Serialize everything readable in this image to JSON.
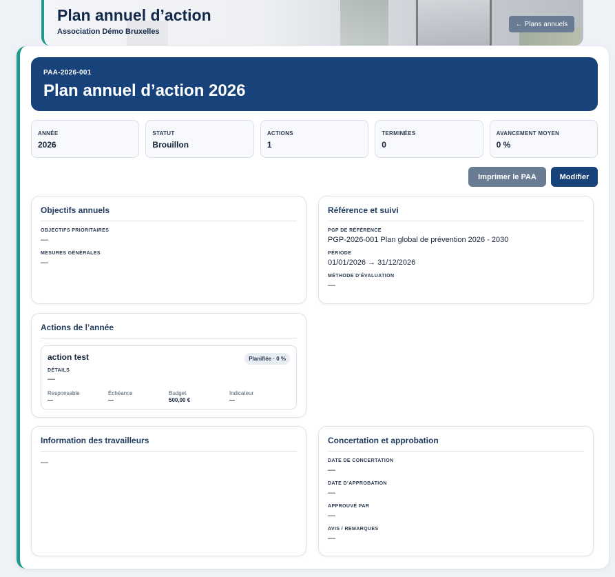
{
  "banner": {
    "title": "Plan annuel d’action",
    "subtitle": "Association Démo Bruxelles",
    "back_label": "← Plans annuels"
  },
  "hero": {
    "reference": "PAA-2026-001",
    "title": "Plan annuel d’action 2026"
  },
  "stats": [
    {
      "label": "ANNÉE",
      "value": "2026"
    },
    {
      "label": "STATUT",
      "value": "Brouillon"
    },
    {
      "label": "ACTIONS",
      "value": "1"
    },
    {
      "label": "TERMINÉES",
      "value": "0"
    },
    {
      "label": "AVANCEMENT MOYEN",
      "value": "0 %"
    }
  ],
  "toolbar": {
    "print_label": "Imprimer le PAA",
    "edit_label": "Modifier"
  },
  "objectives": {
    "title": "Objectifs annuels",
    "fields": [
      {
        "label": "OBJECTIFS PRIORITAIRES",
        "value": "—"
      },
      {
        "label": "MESURES GÉNÉRALES",
        "value": "—"
      }
    ]
  },
  "reference": {
    "title": "Référence et suivi",
    "fields": [
      {
        "label": "PGP DE RÉFÉRENCE",
        "value": "PGP-2026-001 Plan global de prévention 2026 - 2030"
      },
      {
        "label": "PÉRIODE",
        "value": "01/01/2026 → 31/12/2026"
      },
      {
        "label": "MÉTHODE D’ÉVALUATION",
        "value": "—"
      }
    ]
  },
  "year_actions": {
    "title": "Actions de l’année",
    "items": [
      {
        "name": "action test",
        "badge": "Planifiée · 0 %",
        "details_label": "DÉTAILS",
        "details_value": "—",
        "meta": [
          {
            "label": "Responsable",
            "value": "—"
          },
          {
            "label": "Échéance",
            "value": "—"
          },
          {
            "label": "Budget",
            "value": "500,00 €"
          },
          {
            "label": "Indicateur",
            "value": "—"
          }
        ]
      }
    ]
  },
  "workers_info": {
    "title": "Information des travailleurs",
    "value": "—"
  },
  "consultation": {
    "title": "Concertation et approbation",
    "fields": [
      {
        "label": "DATE DE CONCERTATION",
        "value": "—"
      },
      {
        "label": "DATE D’APPROBATION",
        "value": "—"
      },
      {
        "label": "APPROUVÉ PAR",
        "value": "—"
      },
      {
        "label": "AVIS / REMARQUES",
        "value": "—"
      }
    ]
  }
}
